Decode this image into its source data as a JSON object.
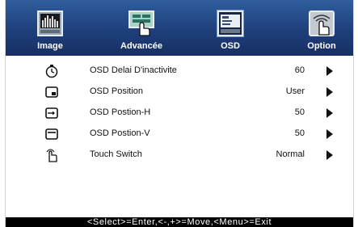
{
  "tabs": [
    {
      "label": "Image",
      "icon": "image-icon"
    },
    {
      "label": "Advancée",
      "icon": "advanced-settings-icon"
    },
    {
      "label": "OSD",
      "icon": "osd-icon",
      "active": true
    },
    {
      "label": "Option",
      "icon": "touch-option-icon"
    }
  ],
  "settings": [
    {
      "label": "OSD Delai D'inactivite",
      "value": "60",
      "icon": "timer-icon"
    },
    {
      "label": "OSD Position",
      "value": "User",
      "icon": "osd-position-icon"
    },
    {
      "label": "OSD Postion-H",
      "value": "50",
      "icon": "horizontal-position-icon"
    },
    {
      "label": "OSD Postion-V",
      "value": "50",
      "icon": "vertical-position-icon"
    },
    {
      "label": "Touch Switch",
      "value": "Normal",
      "icon": "touch-hand-icon"
    }
  ],
  "footer": {
    "hint": "<Select>=Enter,<-,+>=Move,<Menu>=Exit"
  },
  "colors": {
    "tab_bar": "#1f3f7c",
    "footer_bg": "#000000",
    "text": "#111111"
  }
}
